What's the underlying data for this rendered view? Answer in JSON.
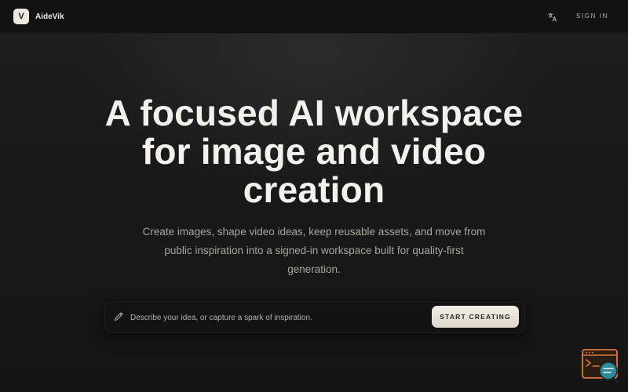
{
  "header": {
    "logo_letter": "V",
    "brand_name": "AideVik",
    "language_icon": "translate-icon",
    "signin_label": "SIGN IN"
  },
  "hero": {
    "title": "A focused AI workspace for image and video creation",
    "subtitle": "Create images, shape video ideas, keep reusable assets, and move from public inspiration into a signed-in workspace built for quality-first generation."
  },
  "prompt": {
    "icon": "pencil-icon",
    "placeholder": "Describe your idea, or capture a spark of inspiration.",
    "value": "",
    "cta_label": "START CREATING"
  },
  "floating_widget": {
    "icon": "support-widget-icon"
  },
  "colors": {
    "background": "#161616",
    "topbar": "#121212",
    "title": "#f4f1ec",
    "subtitle": "#a9a59e",
    "cta_bg": "#ece7de",
    "widget_accent": "#e0763a",
    "widget_secondary": "#2f8a9a"
  }
}
